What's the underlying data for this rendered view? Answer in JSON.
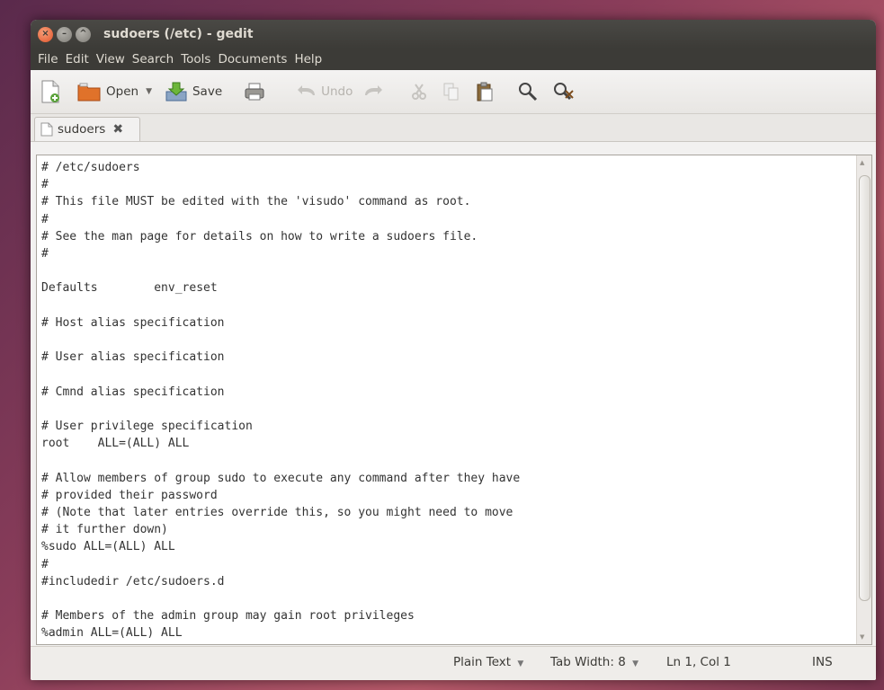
{
  "window": {
    "title": "sudoers (/etc) - gedit"
  },
  "menubar": {
    "items": [
      "File",
      "Edit",
      "View",
      "Search",
      "Tools",
      "Documents",
      "Help"
    ]
  },
  "toolbar": {
    "open_label": "Open",
    "save_label": "Save",
    "undo_label": "Undo"
  },
  "tab": {
    "label": "sudoers"
  },
  "editor": {
    "content": "# /etc/sudoers\n#\n# This file MUST be edited with the 'visudo' command as root.\n#\n# See the man page for details on how to write a sudoers file.\n#\n\nDefaults\tenv_reset\n\n# Host alias specification\n\n# User alias specification\n\n# Cmnd alias specification\n\n# User privilege specification\nroot\tALL=(ALL) ALL\n\n# Allow members of group sudo to execute any command after they have\n# provided their password\n# (Note that later entries override this, so you might need to move\n# it further down)\n%sudo ALL=(ALL) ALL\n#\n#includedir /etc/sudoers.d\n\n# Members of the admin group may gain root privileges\n%admin ALL=(ALL) ALL"
  },
  "statusbar": {
    "language": "Plain Text",
    "tab_width": "Tab Width: 8",
    "position": "Ln 1, Col 1",
    "mode": "INS"
  },
  "colors": {
    "titlebar": "#3c3b37",
    "close_button": "#e0532a",
    "accent": "#f07746"
  }
}
